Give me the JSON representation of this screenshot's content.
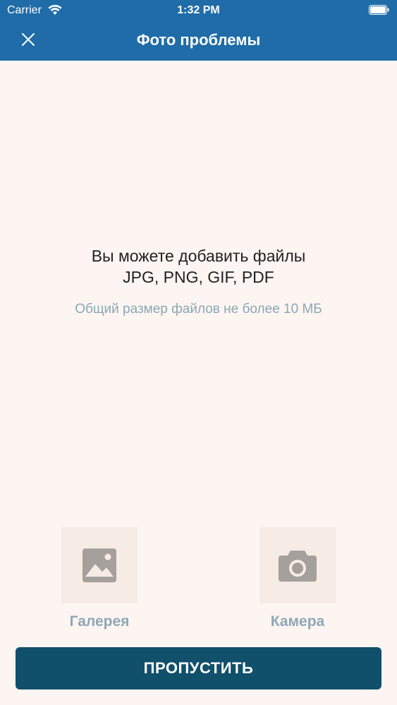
{
  "status_bar": {
    "carrier": "Carrier",
    "time": "1:32 PM",
    "icons": [
      "wifi-icon",
      "battery-icon"
    ]
  },
  "header": {
    "title": "Фото проблемы",
    "close_icon": "close-icon",
    "background_color": "#1f6ca8"
  },
  "main": {
    "message_line1": "Вы можете добавить файлы",
    "message_line2": "JPG, PNG, GIF, PDF",
    "size_hint": "Общий размер файлов не более 10 МБ"
  },
  "sources": {
    "gallery": {
      "label": "Галерея",
      "icon": "image-icon"
    },
    "camera": {
      "label": "Камера",
      "icon": "camera-icon"
    }
  },
  "actions": {
    "skip_label": "ПРОПУСТИТЬ",
    "skip_color": "#11506b"
  }
}
